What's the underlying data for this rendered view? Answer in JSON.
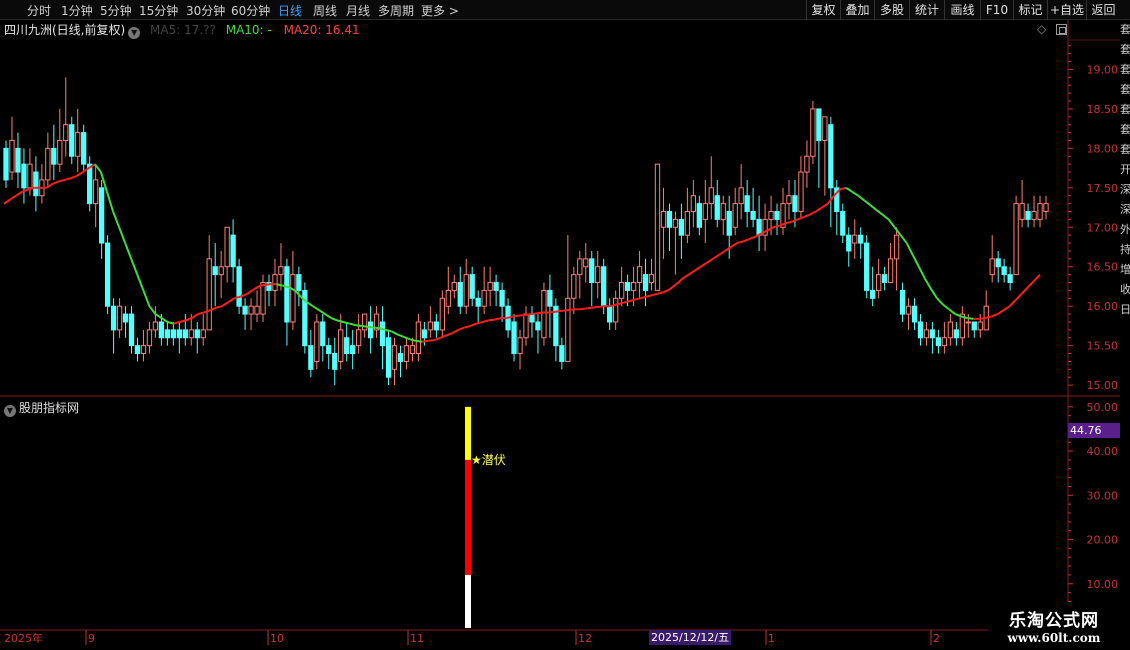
{
  "toolbar": {
    "periods": [
      "分时",
      "1分钟",
      "5分钟",
      "15分钟",
      "30分钟",
      "60分钟",
      "日线",
      "周线",
      "月线",
      "多周期",
      "更多 >"
    ],
    "active_period": "日线",
    "right_buttons": [
      "复权",
      "叠加",
      "多股",
      "统计",
      "画线",
      "F10",
      "标记",
      "+自选",
      "返回"
    ]
  },
  "price_panel": {
    "stock_name": "四川九洲(日线,前复权)",
    "ma5_text": "MA5: 17.??",
    "ma10_text": "MA10: -",
    "ma20_text": "MA20: 16.41"
  },
  "indicator_panel": {
    "name": "股朋指标网",
    "last_value": "44.76",
    "signal_label": "★潜伏"
  },
  "x_axis": {
    "year_label": "2025年",
    "month_labels": [
      "9",
      "10",
      "11",
      "12",
      "1",
      "2"
    ],
    "cursor_date": "2025/12/12/五"
  },
  "right_strip_glyphs": [
    "套",
    "套",
    "套",
    "套",
    "套",
    "套",
    "套",
    "开",
    "深",
    "深",
    "外",
    "持",
    "增",
    "收",
    "日"
  ],
  "watermark": {
    "title": "乐淘公式网",
    "url": "www.60lt.com"
  },
  "colors": {
    "up": "#ff7f6e",
    "down": "#54ffff",
    "ma_up": "#ff1c1c",
    "ma_down": "#3cde3c",
    "axis": "#c83232",
    "bar_yellow": "#ffff00",
    "bar_red": "#ff0000",
    "bar_white": "#ffffff"
  },
  "chart_data": [
    {
      "type": "candlestick",
      "title": "四川九洲(日线,前复权)",
      "ylim": [
        14.9,
        19.5
      ],
      "y_ticks": [
        15.0,
        15.5,
        16.0,
        16.5,
        17.0,
        17.5,
        18.0,
        18.5,
        19.0
      ],
      "candles": [
        [
          18.0,
          17.6,
          18.1,
          17.5
        ],
        [
          17.7,
          18.1,
          18.4,
          17.6
        ],
        [
          18.0,
          17.7,
          18.2,
          17.5
        ],
        [
          17.8,
          17.5,
          18.0,
          17.3
        ],
        [
          17.5,
          17.8,
          18.0,
          17.4
        ],
        [
          17.7,
          17.4,
          17.9,
          17.2
        ],
        [
          17.4,
          17.6,
          17.8,
          17.3
        ],
        [
          17.6,
          18.0,
          18.2,
          17.5
        ],
        [
          18.0,
          17.8,
          18.3,
          17.6
        ],
        [
          17.8,
          18.1,
          18.5,
          17.7
        ],
        [
          18.1,
          18.3,
          18.9,
          17.9
        ],
        [
          18.3,
          17.9,
          18.4,
          17.8
        ],
        [
          17.9,
          18.2,
          18.5,
          17.7
        ],
        [
          18.2,
          17.8,
          18.3,
          17.7
        ],
        [
          17.8,
          17.3,
          17.9,
          17.2
        ],
        [
          17.3,
          17.6,
          17.8,
          17.0
        ],
        [
          17.5,
          16.8,
          17.6,
          16.6
        ],
        [
          16.8,
          16.0,
          16.9,
          15.9
        ],
        [
          16.0,
          15.7,
          16.1,
          15.4
        ],
        [
          15.7,
          16.0,
          16.1,
          15.6
        ],
        [
          15.9,
          15.8,
          16.0,
          15.6
        ],
        [
          15.9,
          15.5,
          16.0,
          15.4
        ],
        [
          15.5,
          15.4,
          15.6,
          15.3
        ],
        [
          15.4,
          15.5,
          15.7,
          15.3
        ],
        [
          15.5,
          15.7,
          15.8,
          15.4
        ],
        [
          15.7,
          15.8,
          16.0,
          15.6
        ],
        [
          15.8,
          15.6,
          15.9,
          15.5
        ],
        [
          15.7,
          15.6,
          15.8,
          15.5
        ],
        [
          15.7,
          15.6,
          15.8,
          15.5
        ],
        [
          15.7,
          15.6,
          15.8,
          15.4
        ],
        [
          15.7,
          15.6,
          15.9,
          15.5
        ],
        [
          15.6,
          15.7,
          15.9,
          15.5
        ],
        [
          15.7,
          15.6,
          15.8,
          15.4
        ],
        [
          15.6,
          15.7,
          15.9,
          15.5
        ],
        [
          15.7,
          16.6,
          16.9,
          15.7
        ],
        [
          16.5,
          16.4,
          16.8,
          16.0
        ],
        [
          16.4,
          16.5,
          16.7,
          16.1
        ],
        [
          16.5,
          17.0,
          17.0,
          16.3
        ],
        [
          16.9,
          16.5,
          17.1,
          16.3
        ],
        [
          16.5,
          16.0,
          16.6,
          15.9
        ],
        [
          16.0,
          15.9,
          16.1,
          15.7
        ],
        [
          15.9,
          16.0,
          16.1,
          15.7
        ],
        [
          15.9,
          16.0,
          16.2,
          15.8
        ],
        [
          15.9,
          16.3,
          16.4,
          15.8
        ],
        [
          16.3,
          16.2,
          16.4,
          16.0
        ],
        [
          16.2,
          16.4,
          16.6,
          16.0
        ],
        [
          16.4,
          16.5,
          16.8,
          16.2
        ],
        [
          16.5,
          15.8,
          16.6,
          15.5
        ],
        [
          15.8,
          16.4,
          16.7,
          15.7
        ],
        [
          16.4,
          16.2,
          16.5,
          16.0
        ],
        [
          16.2,
          15.5,
          16.3,
          15.4
        ],
        [
          15.5,
          15.2,
          15.7,
          15.1
        ],
        [
          15.3,
          15.8,
          15.9,
          15.2
        ],
        [
          15.8,
          15.5,
          15.9,
          15.3
        ],
        [
          15.5,
          15.4,
          15.6,
          15.2
        ],
        [
          15.4,
          15.2,
          15.6,
          15.0
        ],
        [
          15.3,
          15.7,
          15.9,
          15.2
        ],
        [
          15.6,
          15.4,
          15.8,
          15.3
        ],
        [
          15.5,
          15.4,
          15.7,
          15.2
        ],
        [
          15.5,
          15.7,
          15.9,
          15.4
        ],
        [
          15.7,
          15.9,
          15.9,
          15.6
        ],
        [
          15.8,
          15.6,
          16.0,
          15.4
        ],
        [
          15.7,
          15.9,
          16.0,
          15.6
        ],
        [
          15.8,
          15.5,
          16.0,
          15.2
        ],
        [
          15.6,
          15.1,
          15.7,
          15.0
        ],
        [
          15.2,
          15.5,
          15.6,
          15.0
        ],
        [
          15.4,
          15.3,
          15.5,
          15.1
        ],
        [
          15.3,
          15.5,
          15.6,
          15.2
        ],
        [
          15.4,
          15.5,
          15.6,
          15.3
        ],
        [
          15.4,
          15.8,
          15.9,
          15.3
        ],
        [
          15.7,
          15.6,
          15.8,
          15.5
        ],
        [
          15.7,
          15.8,
          16.0,
          15.6
        ],
        [
          15.8,
          15.7,
          15.9,
          15.6
        ],
        [
          15.7,
          16.1,
          16.2,
          15.6
        ],
        [
          16.0,
          16.2,
          16.5,
          15.9
        ],
        [
          16.2,
          16.3,
          16.4,
          16.1
        ],
        [
          16.3,
          16.0,
          16.5,
          15.9
        ],
        [
          16.0,
          16.4,
          16.6,
          15.9
        ],
        [
          16.4,
          16.1,
          16.5,
          16.0
        ],
        [
          16.1,
          16.0,
          16.2,
          15.8
        ],
        [
          16.0,
          16.2,
          16.5,
          15.9
        ],
        [
          16.2,
          16.3,
          16.5,
          16.0
        ],
        [
          16.3,
          16.2,
          16.4,
          16.0
        ],
        [
          16.2,
          16.0,
          16.3,
          15.8
        ],
        [
          16.0,
          15.7,
          16.1,
          15.6
        ],
        [
          15.8,
          15.4,
          15.9,
          15.3
        ],
        [
          15.4,
          15.6,
          15.7,
          15.2
        ],
        [
          15.6,
          15.9,
          16.0,
          15.5
        ],
        [
          15.9,
          15.8,
          16.0,
          15.6
        ],
        [
          15.8,
          15.7,
          15.9,
          15.4
        ],
        [
          15.6,
          16.2,
          16.3,
          15.5
        ],
        [
          16.2,
          16.0,
          16.4,
          15.6
        ],
        [
          16.0,
          15.5,
          16.1,
          15.3
        ],
        [
          15.5,
          15.3,
          15.6,
          15.2
        ],
        [
          15.3,
          16.1,
          16.9,
          15.3
        ],
        [
          16.1,
          16.4,
          16.5,
          15.9
        ],
        [
          16.4,
          16.6,
          16.7,
          16.1
        ],
        [
          16.5,
          16.6,
          16.8,
          16.3
        ],
        [
          16.6,
          16.3,
          16.7,
          16.0
        ],
        [
          16.3,
          16.5,
          16.7,
          16.1
        ],
        [
          16.5,
          16.0,
          16.6,
          15.9
        ],
        [
          16.0,
          15.8,
          16.1,
          15.7
        ],
        [
          15.8,
          16.1,
          16.2,
          15.7
        ],
        [
          16.1,
          16.3,
          16.5,
          16.0
        ],
        [
          16.3,
          16.2,
          16.4,
          16.0
        ],
        [
          16.2,
          16.3,
          16.5,
          16.0
        ],
        [
          16.3,
          16.5,
          16.7,
          16.1
        ],
        [
          16.4,
          16.2,
          16.6,
          16.0
        ],
        [
          16.3,
          16.4,
          16.6,
          16.2
        ],
        [
          16.2,
          17.8,
          17.8,
          16.2
        ],
        [
          17.0,
          17.2,
          17.5,
          16.6
        ],
        [
          17.2,
          17.0,
          17.3,
          16.7
        ],
        [
          17.0,
          17.1,
          17.2,
          16.4
        ],
        [
          17.1,
          16.9,
          17.3,
          16.6
        ],
        [
          16.9,
          17.2,
          17.5,
          16.8
        ],
        [
          17.2,
          17.4,
          17.6,
          17.0
        ],
        [
          17.3,
          17.0,
          17.4,
          16.9
        ],
        [
          17.1,
          17.3,
          17.6,
          16.8
        ],
        [
          17.3,
          17.5,
          17.9,
          17.1
        ],
        [
          17.4,
          17.1,
          17.6,
          17.0
        ],
        [
          17.1,
          17.3,
          17.4,
          16.9
        ],
        [
          17.2,
          16.9,
          17.4,
          16.6
        ],
        [
          17.0,
          17.3,
          17.5,
          16.9
        ],
        [
          17.3,
          17.5,
          17.8,
          17.1
        ],
        [
          17.4,
          17.2,
          17.6,
          17.0
        ],
        [
          17.2,
          17.1,
          17.5,
          17.0
        ],
        [
          17.1,
          16.9,
          17.4,
          16.7
        ],
        [
          16.9,
          17.1,
          17.3,
          16.7
        ],
        [
          17.1,
          17.2,
          17.4,
          16.9
        ],
        [
          17.2,
          17.1,
          17.3,
          16.9
        ],
        [
          17.0,
          17.3,
          17.5,
          16.9
        ],
        [
          17.3,
          17.4,
          17.6,
          17.1
        ],
        [
          17.4,
          17.2,
          17.6,
          17.0
        ],
        [
          17.2,
          17.7,
          17.9,
          17.1
        ],
        [
          17.7,
          17.9,
          18.1,
          17.5
        ],
        [
          17.9,
          18.5,
          18.6,
          17.8
        ],
        [
          18.5,
          18.1,
          18.5,
          17.5
        ],
        [
          18.1,
          18.4,
          18.4,
          17.4
        ],
        [
          18.3,
          17.5,
          18.4,
          17.0
        ],
        [
          17.5,
          17.2,
          17.6,
          16.9
        ],
        [
          17.2,
          16.9,
          17.3,
          16.8
        ],
        [
          16.9,
          16.7,
          17.0,
          16.5
        ],
        [
          16.8,
          16.9,
          17.1,
          16.6
        ],
        [
          16.9,
          16.8,
          17.0,
          16.6
        ],
        [
          16.8,
          16.2,
          16.9,
          16.1
        ],
        [
          16.2,
          16.1,
          16.5,
          16.0
        ],
        [
          16.2,
          16.4,
          16.6,
          16.1
        ],
        [
          16.4,
          16.3,
          16.5,
          16.2
        ],
        [
          16.3,
          16.6,
          16.8,
          16.3
        ],
        [
          16.6,
          16.9,
          17.0,
          16.2
        ],
        [
          16.2,
          15.9,
          16.3,
          15.8
        ],
        [
          15.9,
          16.0,
          16.1,
          15.7
        ],
        [
          16.0,
          15.8,
          16.1,
          15.7
        ],
        [
          15.8,
          15.6,
          15.9,
          15.5
        ],
        [
          15.6,
          15.7,
          15.8,
          15.5
        ],
        [
          15.7,
          15.6,
          15.8,
          15.4
        ],
        [
          15.6,
          15.5,
          15.7,
          15.4
        ],
        [
          15.5,
          15.6,
          15.8,
          15.4
        ],
        [
          15.6,
          15.8,
          15.9,
          15.5
        ],
        [
          15.7,
          15.6,
          15.8,
          15.5
        ],
        [
          15.6,
          15.9,
          16.0,
          15.5
        ],
        [
          15.8,
          15.8,
          15.9,
          15.6
        ],
        [
          15.8,
          15.7,
          15.8,
          15.6
        ],
        [
          15.7,
          15.8,
          15.9,
          15.6
        ],
        [
          15.7,
          16.0,
          16.2,
          15.7
        ],
        [
          16.4,
          16.6,
          16.9,
          16.3
        ],
        [
          16.6,
          16.5,
          16.7,
          16.3
        ],
        [
          16.5,
          16.4,
          16.6,
          16.3
        ],
        [
          16.4,
          16.3,
          16.5,
          16.2
        ],
        [
          16.4,
          17.3,
          17.4,
          16.4
        ],
        [
          17.1,
          17.3,
          17.6,
          17.0
        ],
        [
          17.2,
          17.1,
          17.3,
          17.0
        ],
        [
          17.1,
          17.2,
          17.4,
          17.0
        ],
        [
          17.1,
          17.3,
          17.4,
          17.0
        ],
        [
          17.2,
          17.3,
          17.4,
          17.1
        ]
      ],
      "ma20": [
        17.3,
        17.35,
        17.4,
        17.45,
        17.48,
        17.5,
        17.5,
        17.5,
        17.55,
        17.58,
        17.6,
        17.62,
        17.65,
        17.7,
        17.75,
        17.8,
        17.7,
        17.45,
        17.2,
        17.0,
        16.8,
        16.6,
        16.4,
        16.2,
        16.0,
        15.9,
        15.85,
        15.8,
        15.78,
        15.8,
        15.82,
        15.85,
        15.9,
        15.92,
        15.95,
        15.98,
        16.0,
        16.05,
        16.1,
        16.12,
        16.15,
        16.2,
        16.25,
        16.27,
        16.28,
        16.28,
        16.26,
        16.24,
        16.2,
        16.12,
        16.05,
        16.0,
        15.95,
        15.9,
        15.85,
        15.82,
        15.8,
        15.78,
        15.76,
        15.75,
        15.74,
        15.73,
        15.72,
        15.7,
        15.68,
        15.64,
        15.61,
        15.58,
        15.56,
        15.55,
        15.56,
        15.57,
        15.6,
        15.63,
        15.66,
        15.7,
        15.73,
        15.75,
        15.78,
        15.8,
        15.82,
        15.83,
        15.85,
        15.85,
        15.87,
        15.88,
        15.89,
        15.9,
        15.91,
        15.92,
        15.92,
        15.93,
        15.94,
        15.95,
        15.96,
        15.96,
        15.97,
        15.98,
        15.99,
        16.0,
        16.0,
        16.02,
        16.04,
        16.06,
        16.08,
        16.1,
        16.12,
        16.14,
        16.16,
        16.18,
        16.22,
        16.28,
        16.35,
        16.4,
        16.45,
        16.5,
        16.55,
        16.6,
        16.65,
        16.7,
        16.75,
        16.8,
        16.82,
        16.85,
        16.88,
        16.92,
        16.96,
        17.0,
        17.02,
        17.05,
        17.07,
        17.1,
        17.13,
        17.16,
        17.2,
        17.25,
        17.3,
        17.4,
        17.48,
        17.5,
        17.45,
        17.4,
        17.34,
        17.28,
        17.22,
        17.16,
        17.1,
        17.0,
        16.9,
        16.8,
        16.65,
        16.5,
        16.35,
        16.22,
        16.1,
        16.02,
        15.96,
        15.9,
        15.87,
        15.85,
        15.84,
        15.84,
        15.85,
        15.87,
        15.9,
        15.95,
        16.0,
        16.08,
        16.16,
        16.24,
        16.32,
        16.4
      ],
      "ma20_trend": "up",
      "ma_note": "line colored red when rising, green when falling"
    },
    {
      "type": "bar",
      "title": "股朋指标网",
      "ylim": [
        0,
        52
      ],
      "y_ticks": [
        10,
        20,
        30,
        40,
        50
      ],
      "signal_bar": {
        "top_value": 50,
        "yellow_to": 38,
        "red_to": 12,
        "white_to": 0
      },
      "last_value": 44.76
    }
  ]
}
